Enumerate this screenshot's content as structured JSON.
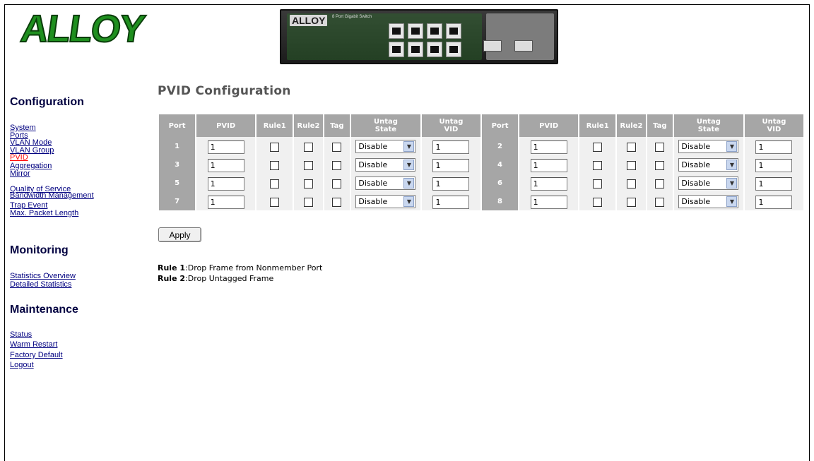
{
  "brand": {
    "logo": "ALLOY",
    "device_brand": "ALLOY",
    "device_model": "8 Port Gigabit Switch"
  },
  "sidebar": {
    "configuration_heading": "Configuration",
    "configuration_items": [
      {
        "label": "System"
      },
      {
        "label": "Ports"
      },
      {
        "label": "VLAN Mode"
      },
      {
        "label": "VLAN Group"
      },
      {
        "label": "PVID",
        "active": true
      },
      {
        "label": "Aggregation"
      },
      {
        "label": "Mirror"
      },
      {
        "label": "Quality of Service"
      },
      {
        "label": "Bandwidth Management"
      },
      {
        "label": "Trap Event"
      },
      {
        "label": "Max. Packet Length"
      }
    ],
    "monitoring_heading": "Monitoring",
    "monitoring_items": [
      {
        "label": "Statistics Overview"
      },
      {
        "label": "Detailed Statistics"
      }
    ],
    "maintenance_heading": "Maintenance",
    "maintenance_items": [
      {
        "label": "Status"
      },
      {
        "label": "Warm Restart"
      },
      {
        "label": "Factory Default"
      },
      {
        "label": "Logout"
      }
    ],
    "active_color": "#ff0000",
    "link_color": "#000080"
  },
  "main": {
    "title": "PVID Configuration",
    "headers": {
      "port": "Port",
      "pvid": "PVID",
      "rule1": "Rule1",
      "rule2": "Rule2",
      "tag": "Tag",
      "untag_state_1": "Untag",
      "untag_state_2": "State",
      "untag_vid_1": "Untag",
      "untag_vid_2": "VID"
    },
    "rows": [
      {
        "left": {
          "port": "1",
          "pvid": "1",
          "rule1": false,
          "rule2": false,
          "tag": false,
          "untag_state": "Disable",
          "untag_vid": "1"
        },
        "right": {
          "port": "2",
          "pvid": "1",
          "rule1": false,
          "rule2": false,
          "tag": false,
          "untag_state": "Disable",
          "untag_vid": "1"
        }
      },
      {
        "left": {
          "port": "3",
          "pvid": "1",
          "rule1": false,
          "rule2": false,
          "tag": false,
          "untag_state": "Disable",
          "untag_vid": "1"
        },
        "right": {
          "port": "4",
          "pvid": "1",
          "rule1": false,
          "rule2": false,
          "tag": false,
          "untag_state": "Disable",
          "untag_vid": "1"
        }
      },
      {
        "left": {
          "port": "5",
          "pvid": "1",
          "rule1": false,
          "rule2": false,
          "tag": false,
          "untag_state": "Disable",
          "untag_vid": "1"
        },
        "right": {
          "port": "6",
          "pvid": "1",
          "rule1": false,
          "rule2": false,
          "tag": false,
          "untag_state": "Disable",
          "untag_vid": "1"
        }
      },
      {
        "left": {
          "port": "7",
          "pvid": "1",
          "rule1": false,
          "rule2": false,
          "tag": false,
          "untag_state": "Disable",
          "untag_vid": "1"
        },
        "right": {
          "port": "8",
          "pvid": "1",
          "rule1": false,
          "rule2": false,
          "tag": false,
          "untag_state": "Disable",
          "untag_vid": "1"
        }
      }
    ],
    "apply_label": "Apply",
    "legend": [
      {
        "key": "Rule 1",
        "text": "Drop Frame from Nonmember Port"
      },
      {
        "key": "Rule 2",
        "text": "Drop Untagged Frame"
      }
    ],
    "header_bg": "#a6a6a6"
  }
}
